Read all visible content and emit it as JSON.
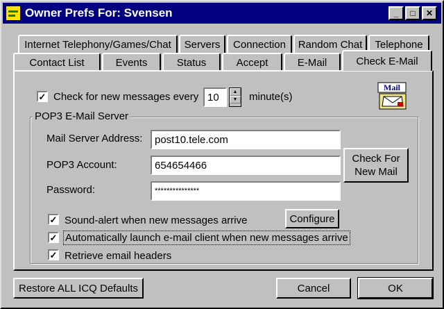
{
  "window": {
    "title": "Owner Prefs For: Svensen"
  },
  "tabs": {
    "row1": [
      "Internet Telephony/Games/Chat",
      "Servers",
      "Connection",
      "Random Chat",
      "Telephone"
    ],
    "row2": [
      "Contact List",
      "Events",
      "Status",
      "Accept",
      "E-Mail",
      "Check E-Mail"
    ]
  },
  "check": {
    "label_before": "Check for new messages every",
    "interval": "10",
    "label_after": "minute(s)",
    "mail_icon_text": "Mail"
  },
  "pop3": {
    "group_label": "POP3 E-Mail Server",
    "server_label": "Mail Server Address:",
    "server_value": "post10.tele.com",
    "account_label": "POP3 Account:",
    "account_value": "654654466",
    "password_label": "Password:",
    "password_value": "***************",
    "check_button": "Check For New Mail"
  },
  "options": {
    "sound_alert": "Sound-alert when new messages arrive",
    "configure_button": "Configure",
    "auto_launch": "Automatically launch e-mail client when new messages arrive",
    "retrieve_headers": "Retrieve email headers"
  },
  "footer": {
    "restore_button": "Restore ALL ICQ Defaults",
    "cancel_button": "Cancel",
    "ok_button": "OK"
  },
  "checks": {
    "periodic": "✓",
    "sound": "✓",
    "launch": "✓",
    "headers": "✓"
  },
  "colors": {
    "titlebar": "#000080",
    "face": "#c0c0c0",
    "field": "#ffffff"
  }
}
